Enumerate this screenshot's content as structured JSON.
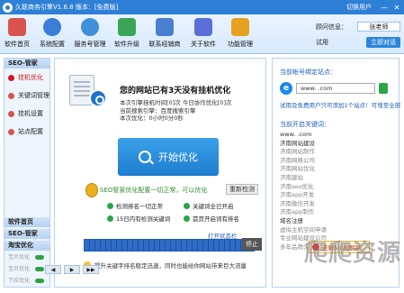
{
  "window": {
    "title": "久联商务引擎V1.6.8 版本：[免费版]",
    "switch_user": "切换用户",
    "min": "—",
    "close": "✕"
  },
  "toolbar": {
    "items": [
      {
        "label": "软件首页",
        "icon": "home-icon",
        "color": "#d9534f"
      },
      {
        "label": "系统配置",
        "icon": "gear-icon",
        "color": "#3b7dd8"
      },
      {
        "label": "服务号管理",
        "icon": "users-icon",
        "color": "#3f8fd9"
      },
      {
        "label": "软件升级",
        "icon": "upgrade-icon",
        "color": "#3aa655"
      },
      {
        "label": "联系经销商",
        "icon": "contact-icon",
        "color": "#4a7fd0"
      },
      {
        "label": "关于软件",
        "icon": "info-icon",
        "color": "#5b6fd6"
      },
      {
        "label": "功能管理",
        "icon": "tools-icon",
        "color": "#e6a21e"
      }
    ],
    "account": {
      "consultant_label": "顾问信息：",
      "consultant_name": "张老师",
      "trial_label": "试用",
      "open_label": "立即对话"
    }
  },
  "sidebar": {
    "section_title": "SEO-管家",
    "items": [
      {
        "label": "挂机优化",
        "active": true,
        "dot": "#d21a1a"
      },
      {
        "label": "关键词管理",
        "active": false,
        "dot": "#d9534f"
      },
      {
        "label": "挂机设置",
        "active": false,
        "dot": "#d9534f"
      },
      {
        "label": "站点配置",
        "active": false,
        "dot": "#d9534f"
      }
    ],
    "foot": [
      {
        "label": "软件首页"
      },
      {
        "label": "SEO-管家"
      },
      {
        "label": "淘宝优化"
      }
    ],
    "sub": [
      {
        "label": "宝贝优化"
      },
      {
        "label": "宝贝优化"
      },
      {
        "label": "下拉优化"
      }
    ]
  },
  "main": {
    "status_title": "您的网站已有3天没有挂机优化",
    "status_lines": [
      "本次引擎挂机时间[0]次    今日协作优化[0]次",
      "当前搜索引擎：百度搜索引擎",
      "本次优化：0小时0分0秒"
    ],
    "start_button": "开始优化",
    "seo_line": "SEO管家优化配置一切正常，可以优化",
    "recheck_button": "重新检测",
    "checks": [
      "检测排名一切正常",
      "关键词全已开启",
      "15日内有检测关键词",
      "首页开启词有排名"
    ],
    "open_status": "打开状态栏",
    "stop_button": "停止",
    "tip": "提升关键字排名稳定迅速，同时也能给你网站带来巨大流量"
  },
  "right": {
    "bind_title": "当前帐号绑定站点：",
    "url_value": "www.          .com",
    "bind_link": "试用及免费用户只可添加1个站点！可增至全部",
    "keywords_title": "当前开启关键词：",
    "keywords": [
      {
        "text": "www.         .com",
        "dim": false
      },
      {
        "text": "济南网站建设",
        "dim": false
      },
      {
        "text": "济南网站制作",
        "dim": true
      },
      {
        "text": "济南网络公司",
        "dim": true
      },
      {
        "text": "济南网站优化",
        "dim": true
      },
      {
        "text": "济南建站",
        "dim": true
      },
      {
        "text": "济南seo优化",
        "dim": true
      },
      {
        "text": "济南app开发",
        "dim": true
      },
      {
        "text": "济南微信开发",
        "dim": true
      },
      {
        "text": "济南app制作",
        "dim": true
      },
      {
        "text": "域名注册",
        "dim": false
      },
      {
        "text": "虚拟主机空间申请",
        "dim": true
      },
      {
        "text": "专业网站建设公司",
        "dim": true
      },
      {
        "text": "多年品牌久联科技",
        "dim": true
      }
    ],
    "popup": "还剩5小时解锁",
    "bottom_buttons": [
      "◀",
      "▶",
      "▶▶"
    ]
  },
  "watermark": "爬爬资源"
}
